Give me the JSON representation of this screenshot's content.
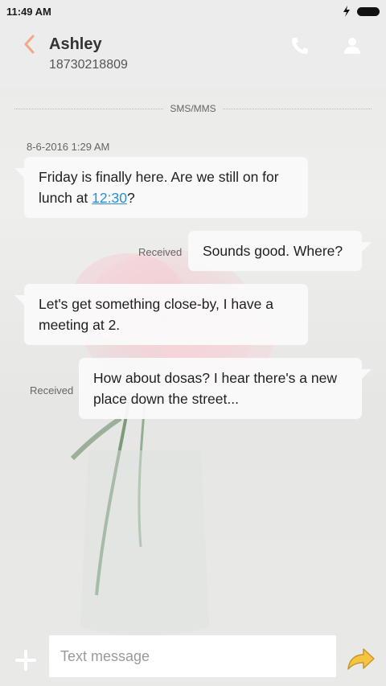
{
  "status_bar": {
    "time": "11:49 AM"
  },
  "header": {
    "contact_name": "Ashley",
    "contact_number": "18730218809"
  },
  "thread": {
    "channel_label": "SMS/MMS",
    "timestamp": "8-6-2016 1:29 AM",
    "messages": [
      {
        "direction": "incoming",
        "text_before": "Friday is finally here. Are we still on for lunch at ",
        "link": "12:30",
        "text_after": "?"
      },
      {
        "direction": "outgoing",
        "status": "Received",
        "text": "Sounds good. Where?"
      },
      {
        "direction": "incoming",
        "text": "Let's get something close-by, I have a meeting at 2."
      },
      {
        "direction": "outgoing",
        "status": "Received",
        "text": "How about dosas? I hear there's a new place down the street..."
      }
    ]
  },
  "compose": {
    "placeholder": "Text message"
  },
  "colors": {
    "accent_back": "#f0a888",
    "link": "#2a8fd6",
    "send_arrow": "#f5c542"
  }
}
